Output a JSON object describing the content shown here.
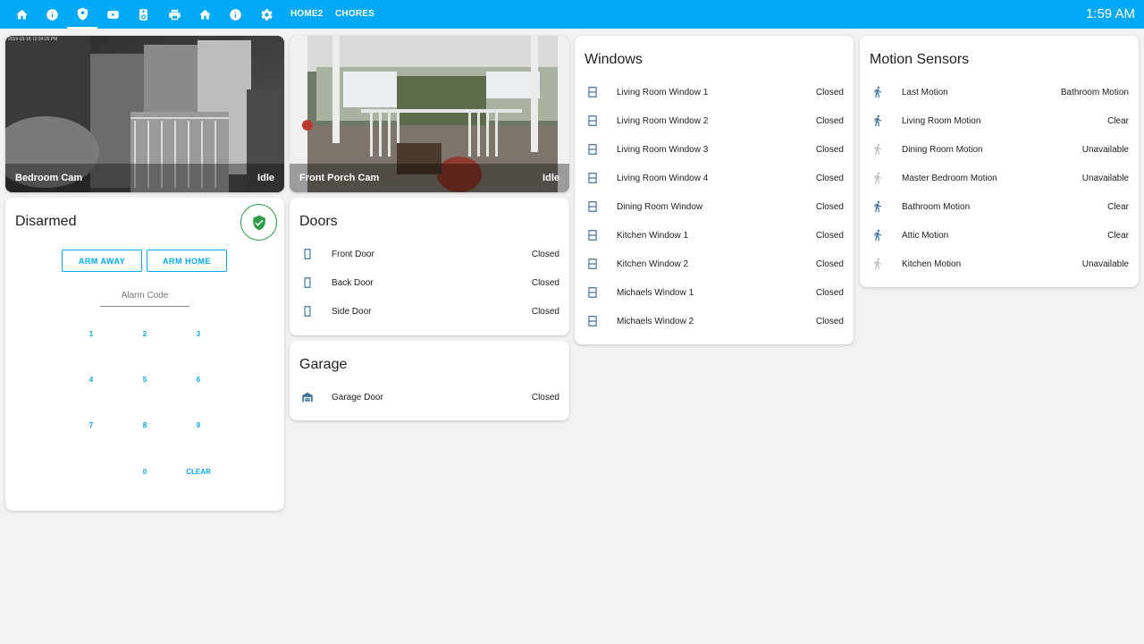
{
  "toolbar": {
    "tabs": [
      {
        "icon": "home-icon"
      },
      {
        "icon": "info-icon"
      },
      {
        "icon": "shield-icon"
      },
      {
        "icon": "youtube-icon"
      },
      {
        "icon": "speaker-icon"
      },
      {
        "icon": "printer-icon"
      },
      {
        "icon": "home-icon"
      },
      {
        "icon": "info-icon"
      },
      {
        "icon": "gear-icon"
      }
    ],
    "text_tabs": [
      "HOME2",
      "CHORES"
    ],
    "clock": "1:59 AM"
  },
  "cameras": [
    {
      "name": "Bedroom Cam",
      "state": "Idle",
      "timestamp": "2019-03-18 12:34:25 PM"
    },
    {
      "name": "Front Porch Cam",
      "state": "Idle"
    }
  ],
  "alarm": {
    "state": "Disarmed",
    "arm_away": "ARM AWAY",
    "arm_home": "ARM HOME",
    "code_placeholder": "Alarm Code",
    "keys": [
      "1",
      "2",
      "3",
      "4",
      "5",
      "6",
      "7",
      "8",
      "9",
      "0",
      "CLEAR"
    ]
  },
  "doors": {
    "title": "Doors",
    "items": [
      {
        "label": "Front Door",
        "state": "Closed"
      },
      {
        "label": "Back Door",
        "state": "Closed"
      },
      {
        "label": "Side Door",
        "state": "Closed"
      }
    ]
  },
  "garage": {
    "title": "Garage",
    "items": [
      {
        "label": "Garage Door",
        "state": "Closed"
      }
    ]
  },
  "windows": {
    "title": "Windows",
    "items": [
      {
        "label": "Living Room Window 1",
        "state": "Closed"
      },
      {
        "label": "Living Room Window 2",
        "state": "Closed"
      },
      {
        "label": "Living Room Window 3",
        "state": "Closed"
      },
      {
        "label": "Living Room Window 4",
        "state": "Closed"
      },
      {
        "label": "Dining Room Window",
        "state": "Closed"
      },
      {
        "label": "Kitchen Window 1",
        "state": "Closed"
      },
      {
        "label": "Kitchen Window 2",
        "state": "Closed"
      },
      {
        "label": "Michaels Window 1",
        "state": "Closed"
      },
      {
        "label": "Michaels Window 2",
        "state": "Closed"
      }
    ]
  },
  "motion": {
    "title": "Motion Sensors",
    "items": [
      {
        "label": "Last Motion",
        "state": "Bathroom Motion"
      },
      {
        "label": "Living Room Motion",
        "state": "Clear"
      },
      {
        "label": "Dining Room Motion",
        "state": "Unavailable"
      },
      {
        "label": "Master Bedroom Motion",
        "state": "Unavailable"
      },
      {
        "label": "Bathroom Motion",
        "state": "Clear"
      },
      {
        "label": "Attic Motion",
        "state": "Clear"
      },
      {
        "label": "Kitchen Motion",
        "state": "Unavailable"
      }
    ]
  },
  "colors": {
    "accent": "#03a9f4",
    "icon": "#44739e",
    "icon_unavailable": "#bdbdbd",
    "armed_ok": "#2d9c46"
  }
}
